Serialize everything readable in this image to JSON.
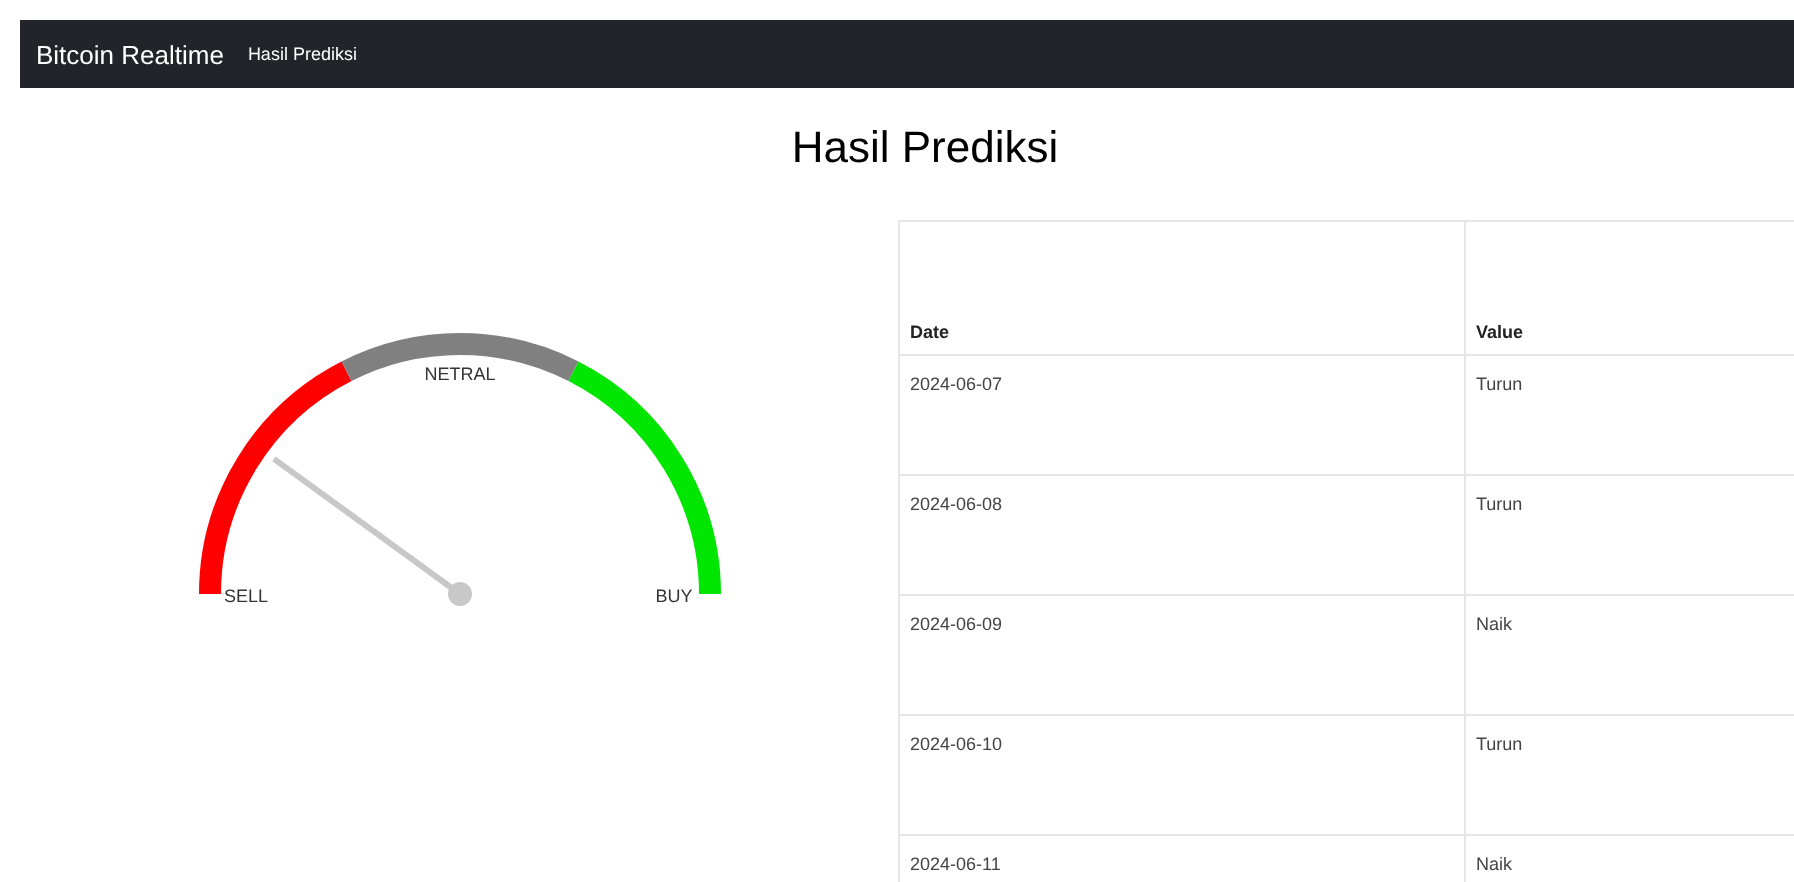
{
  "navbar": {
    "brand": "Bitcoin Realtime",
    "links": [
      {
        "label": "Hasil Prediksi"
      }
    ]
  },
  "title": "Hasil Prediksi",
  "gauge": {
    "zones": [
      {
        "label": "SELL",
        "color": "#ff0000"
      },
      {
        "label": "NETRAL",
        "color": "#808080"
      },
      {
        "label": "BUY",
        "color": "#00e600"
      }
    ]
  },
  "table": {
    "columns": [
      "Date",
      "Value"
    ],
    "rows": [
      [
        "2024-06-07",
        "Turun"
      ],
      [
        "2024-06-08",
        "Turun"
      ],
      [
        "2024-06-09",
        "Naik"
      ],
      [
        "2024-06-10",
        "Turun"
      ],
      [
        "2024-06-11",
        "Naik"
      ]
    ]
  }
}
